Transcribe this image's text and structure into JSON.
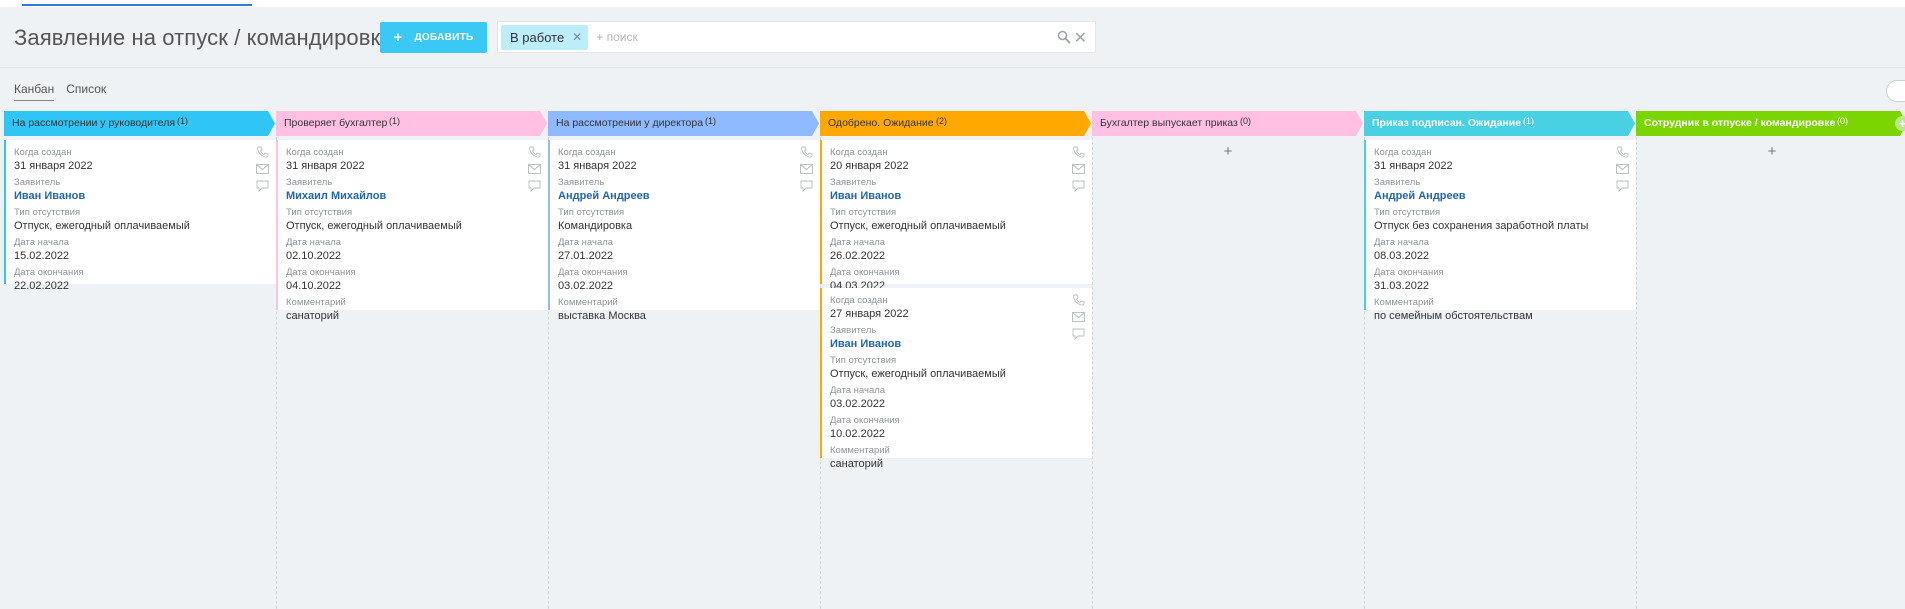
{
  "page": {
    "title": "Заявление на отпуск / командировку",
    "add_label": "ДОБАВИТЬ"
  },
  "search": {
    "chip": "В работе",
    "placeholder": "+ поиск"
  },
  "views": {
    "kanban": "Канбан",
    "list": "Список"
  },
  "fields": {
    "created": "Когда создан",
    "applicant": "Заявитель",
    "absence_type": "Тип отсутствия",
    "start": "Дата начала",
    "end": "Дата окончания",
    "comment": "Комментарий"
  },
  "quick_add": "Быстрый элемент",
  "columns": [
    {
      "title": "На рассмотрении у руководителя",
      "count": "(1)",
      "color": "#2fc6f6",
      "cards": [
        {
          "created": "31 января 2022",
          "applicant": "Иван Иванов",
          "type": "Отпуск, ежегодный оплачиваемый",
          "start": "15.02.2022",
          "end": "22.02.2022",
          "accent": "#2fc6f6"
        }
      ]
    },
    {
      "title": "Проверяет бухгалтер",
      "count": "(1)",
      "color": "#ffc0e3",
      "cards": [
        {
          "created": "31 января 2022",
          "applicant": "Михаил Михайлов",
          "type": "Отпуск, ежегодный оплачиваемый",
          "start": "02.10.2022",
          "end": "04.10.2022",
          "comment": "санаторий",
          "accent": "#ffc0e3"
        }
      ]
    },
    {
      "title": "На рассмотрении у директора",
      "count": "(1)",
      "color": "#8fbaff",
      "cards": [
        {
          "created": "31 января 2022",
          "applicant": "Андрей Андреев",
          "type": "Командировка",
          "start": "27.01.2022",
          "end": "03.02.2022",
          "comment": "выставка Москва",
          "accent": "#8fbaff"
        }
      ]
    },
    {
      "title": "Одобрено. Ожидание",
      "count": "(2)",
      "color": "#ffa900",
      "cards": [
        {
          "created": "20 января 2022",
          "applicant": "Иван Иванов",
          "type": "Отпуск, ежегодный оплачиваемый",
          "start": "26.02.2022",
          "end": "04.03.2022",
          "accent": "#ffa900"
        },
        {
          "created": "27 января 2022",
          "applicant": "Иван Иванов",
          "type": "Отпуск, ежегодный оплачиваемый",
          "start": "03.02.2022",
          "end": "10.02.2022",
          "comment": "санаторий",
          "accent": "#ffa900"
        }
      ]
    },
    {
      "title": "Бухгалтер выпускает приказ",
      "count": "(0)",
      "color": "#ffc0e3",
      "cards": []
    },
    {
      "title": "Приказ подписан. Ожидание",
      "count": "(1)",
      "color": "#47d1e2",
      "cards": [
        {
          "created": "31 января 2022",
          "applicant": "Андрей Андреев",
          "type": "Отпуск без сохранения заработной платы",
          "start": "08.03.2022",
          "end": "31.03.2022",
          "comment": "по семейным обстоятельствам",
          "accent": "#47d1e2"
        }
      ]
    },
    {
      "title": "Сотрудник в отпуске / командировке",
      "count": "(0)",
      "color": "#7bd500",
      "cards": []
    }
  ]
}
